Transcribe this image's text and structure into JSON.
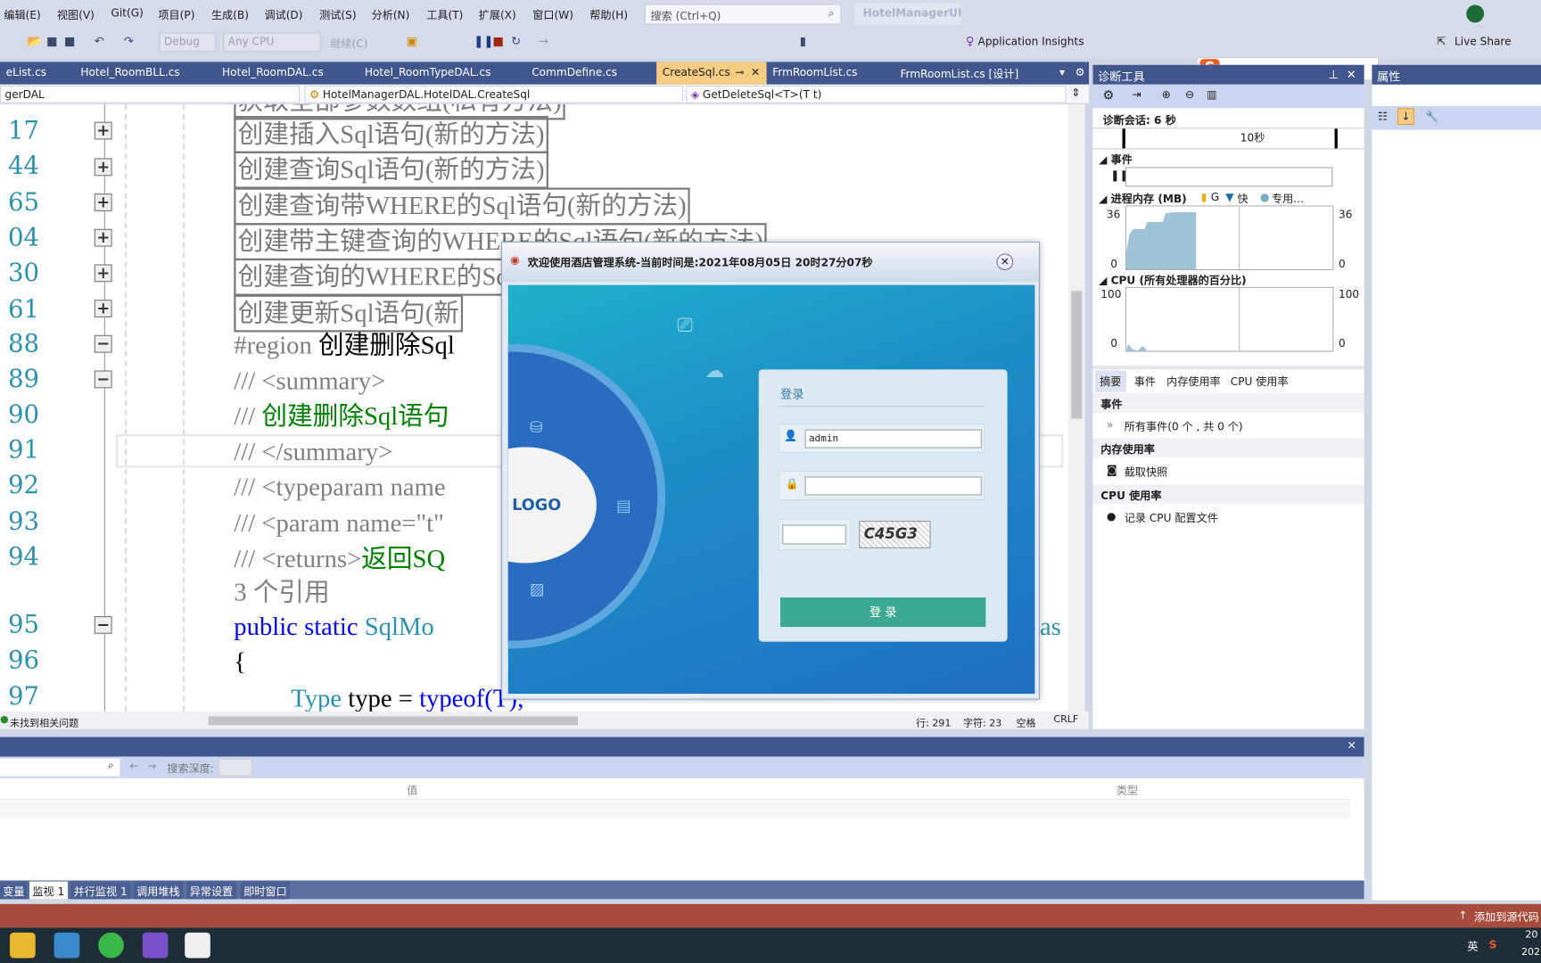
{
  "menu": {
    "items": [
      "编辑(E)",
      "视图(V)",
      "Git(G)",
      "项目(P)",
      "生成(B)",
      "调试(D)",
      "测试(S)",
      "分析(N)",
      "工具(T)",
      "扩展(X)",
      "窗口(W)",
      "帮助(H)"
    ],
    "search_placeholder": "搜索 (Ctrl+Q)",
    "solution_title": "HotelManagerUI"
  },
  "toolbar": {
    "config": "Debug",
    "platform": "Any CPU",
    "continue": "继续(C)",
    "app_insights": "Application Insights",
    "live_share": "Live Share"
  },
  "tabs": [
    "eList.cs",
    "Hotel_RoomBLL.cs",
    "Hotel_RoomDAL.cs",
    "Hotel_RoomTypeDAL.cs",
    "CommDefine.cs",
    "CreateSql.cs",
    "FrmRoomList.cs",
    "FrmRoomList.cs [设计]"
  ],
  "navbar": {
    "project": "gerDAL",
    "class": "HotelManagerDAL.HotelDAL.CreateSql",
    "member": "GetDeleteSql<T>(T t)"
  },
  "editor": {
    "line_numbers": [
      "17",
      "44",
      "65",
      "04",
      "30",
      "61",
      "88",
      "89",
      "90",
      "91",
      "92",
      "93",
      "94",
      "95",
      "96",
      "97"
    ],
    "collapsed": [
      "获取全部参数数组(私有方法)",
      "创建插入Sql语句(新的方法)",
      "创建查询Sql语句(新的方法)",
      "创建查询带WHERE的Sql语句(新的方法)",
      "创建带主键查询的WHERE的Sql语句(新的方法)",
      "创建查询的WHERE的Sql",
      "创建更新Sql语句(新"
    ],
    "region_kw": "#region",
    "region_name": " 创建删除Sql",
    "summary_open": "/// <summary>",
    "doc_prefix": "/// ",
    "doc_text": "创建删除Sql语句",
    "summary_close": "/// </summary>",
    "typeparam": "/// <typeparam name",
    "param": "/// <param name=\"t\"",
    "returns_tag": "/// <returns>",
    "returns_text": "返回SQ",
    "codelens": "3 个引用",
    "sig_kw": "public static ",
    "sig_type": "SqlMo",
    "sig_tail": "as",
    "brace": "{",
    "l297_type": "Type",
    "l297_mid": " type = ",
    "l297_tail": "typeof(T);"
  },
  "editor_status": {
    "issues": "未找到相关问题",
    "line": "行: 291",
    "char": "字符: 23",
    "indent": "空格",
    "eol": "CRLF"
  },
  "diag": {
    "title": "诊断工具",
    "session": "诊断会话: 6 秒",
    "timeline_label": "10秒",
    "events": "事件",
    "memory": "进程内存 (MB)",
    "legend": [
      "G",
      "快",
      "专用..."
    ],
    "mem_max": "36",
    "mem_min": "0",
    "cpu": "CPU (所有处理器的百分比)",
    "cpu_max": "100",
    "cpu_min": "0",
    "tabs": [
      "摘要",
      "事件",
      "内存使用率",
      "CPU 使用率"
    ],
    "sec_events": "事件",
    "all_events": "所有事件(0 个 , 共 0 个)",
    "sec_memory": "内存使用率",
    "snapshot": "截取快照",
    "sec_cpu": "CPU 使用率",
    "record_cpu": "记录 CPU 配置文件",
    "mem_color": "#9fc3d6"
  },
  "properties": {
    "title": "属性"
  },
  "watch": {
    "search_depth": "搜索深度:",
    "col_value": "值",
    "col_type": "类型",
    "tabs": [
      "变量",
      "监视 1",
      "并行监视 1",
      "调用堆栈",
      "异常设置",
      "即时窗口"
    ]
  },
  "statusbar": {
    "source_control": "添加到源代码"
  },
  "tray": {
    "ime": "英",
    "clock_1": "20",
    "clock_2": "202"
  },
  "dialog": {
    "title": "欢迎使用酒店管理系统-当前时间是:2021年08月05日  20时27分07秒",
    "logo": "LOGO",
    "heading": "登录",
    "username": "admin",
    "password": "",
    "captcha_input": "",
    "captcha": "C45G3",
    "login_button": "登 录",
    "accent": "#3aa98f"
  }
}
